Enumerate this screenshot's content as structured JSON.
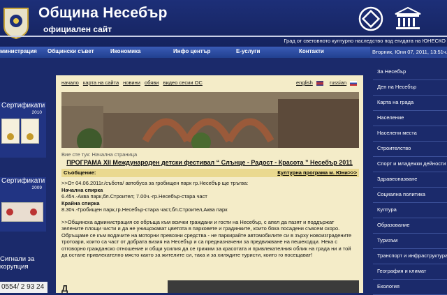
{
  "header": {
    "title": "Община Несебър",
    "subtitle": "официален сайт",
    "unesco_text": "Град от световното културно наследство под егидата на ЮНЕСКО"
  },
  "topnav": [
    "министрация",
    "Общински съвет",
    "Икономика",
    "Инфо център",
    "Е-услуги",
    "Контакти"
  ],
  "date": "Вторник, Юни 07, 2011, 13:51ч.",
  "left": {
    "cert_title": "Сертификати",
    "cert_year1": "2010",
    "cert_year2": "2009",
    "signals": "Сигнали за корупция",
    "phone": "0554/ 2 93 24"
  },
  "rightnav": [
    "За Несебър",
    "Ден на Несебър",
    "Карта на града",
    "Население",
    "Населени места",
    "Строителство",
    "Спорт и младежки дейности",
    "Здравеопазване",
    "Социална политика",
    "Култура",
    "Образование",
    "Туризъм",
    "Транспорт и инфраструктура",
    "География и климат",
    "Екология"
  ],
  "main": {
    "toplinks": [
      "начало",
      "карта на сайта",
      "новини",
      "обяви",
      "видео сесии ОС"
    ],
    "lang_en": "english",
    "lang_ru": "russian",
    "breadcrumb": "Вие сте тук: Начална страница",
    "headline": "ПРОГРАМА XII Международен детски фестивал “ Слънце - Радост - Красота ” Несебър 2011",
    "msg_label": "Съобщение:",
    "msg_link": "Културна програма м. Юни>>>",
    "line1": ">>От 04.06.2011г./събота/ автобуса за гробищен парк гр.Несебър ще тръгва:",
    "start_label": "Начална спирка",
    "start_text": "6.45ч.-Аква парк,бл.Строител; 7.00ч.-гр.Несебър-стара част",
    "end_label": "Крайна спирка",
    "end_text": "8.30ч.-Гробищен парк,гр.Несебър-стара част,бл.Строител,Аква парк",
    "para": ">>Общинска администрация се обръща към всички граждани и гости на Несебър, с апел да пазят и поддържат зелените площи чисти и да не унищожават цветята в парковете и градинките, които бяха посадени съвсем скоро. Обръщаме се към водачите на моторни превозни средства - не паркирайте автомобилите си в зърху новоизградените тротоари, които са част от добрата визия на Несебър и са предназначени за предвижване на пешеходци. Нека с отговорно гражданско отношение и общи усилия да се грижим за красотата и привлекателния облик на града ни и той да остане привлекателно място както за жителите си, така и за хилядите туристи, които го посещават!",
    "tail": "Д"
  },
  "colors": {
    "background": "#1b2a6b",
    "content": "#f4ecc8",
    "nav": "#2a4596"
  }
}
